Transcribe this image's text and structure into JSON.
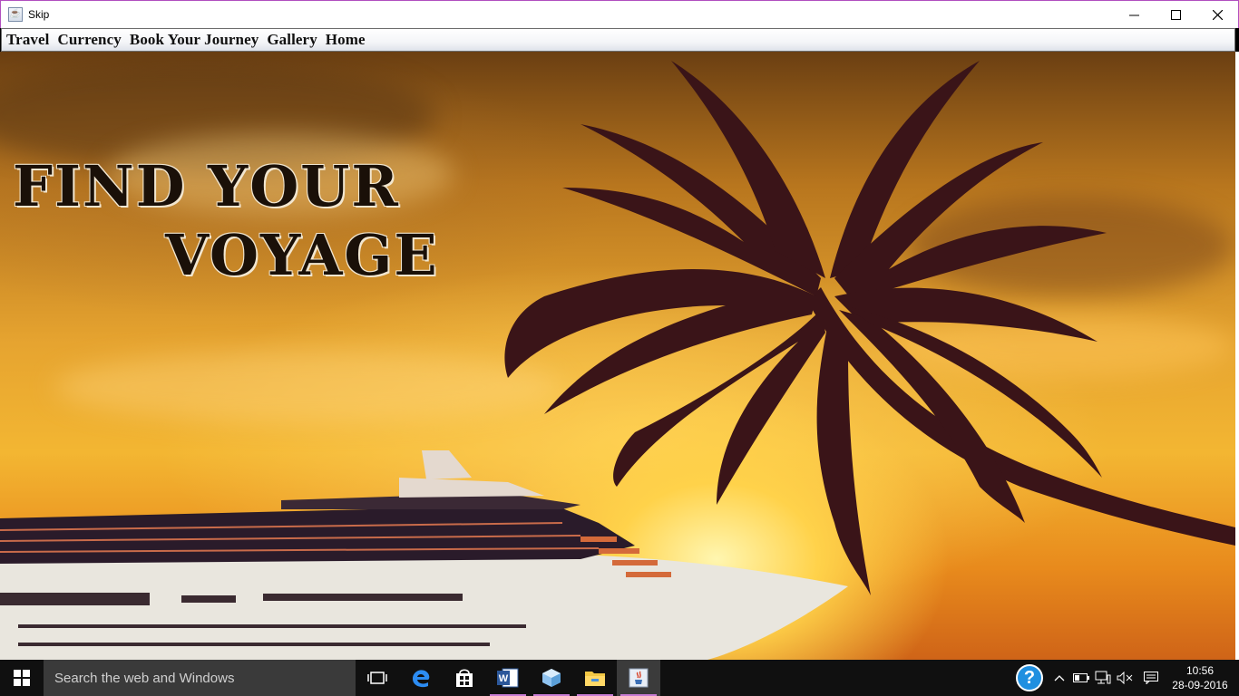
{
  "window": {
    "title": "Skip",
    "controls": {
      "minimize": "—",
      "maximize": "☐",
      "close": "✕"
    }
  },
  "menu": {
    "items": [
      "Travel",
      "Currency",
      "Book Your Journey",
      "Gallery",
      "Home"
    ]
  },
  "hero": {
    "line1": "FIND YOUR",
    "line2": "VOYAGE"
  },
  "taskbar": {
    "search_placeholder": "Search the web and Windows",
    "apps": [
      "task-view-icon",
      "edge-icon",
      "store-icon",
      "word-icon",
      "virtualbox-icon",
      "file-explorer-icon",
      "java-icon"
    ],
    "tray": {
      "help": "?",
      "chevron": "^",
      "time": "10:56",
      "date": "28-09-2016"
    }
  },
  "colors": {
    "title_border": "#b14fbf",
    "taskbar_bg": "#101010",
    "search_bg": "#3a3a3a",
    "running_indicator": "#c77bd3",
    "help_blue": "#1f8fe0"
  }
}
